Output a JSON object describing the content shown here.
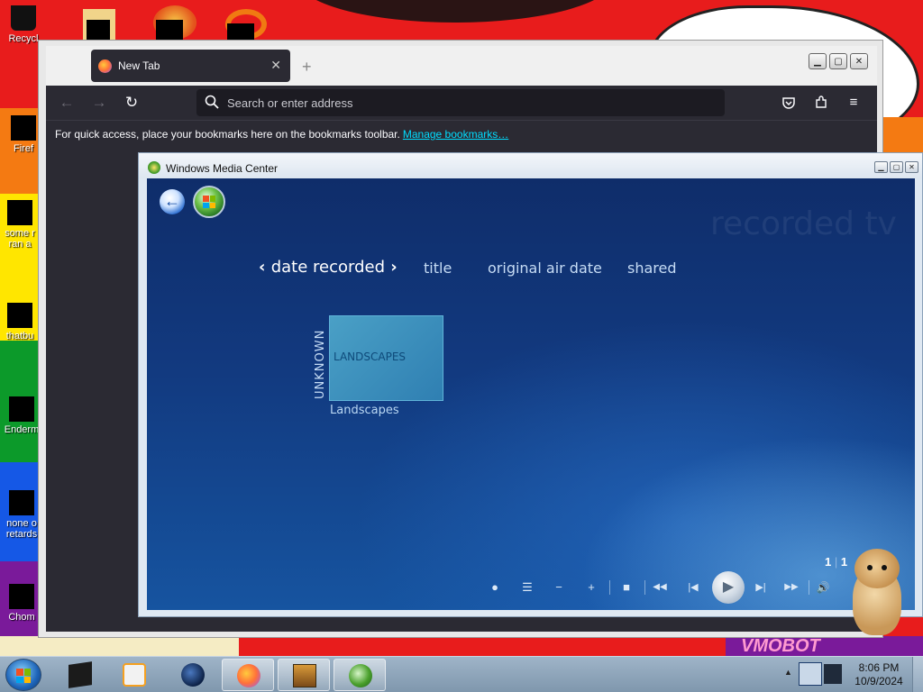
{
  "desktop": {
    "icons": [
      {
        "label": "Recycl",
        "icon": "recycle-bin-icon"
      },
      {
        "label": "Firef",
        "icon": "firefox-icon"
      },
      {
        "label": "some r",
        "label2": "ran a",
        "icon": "file-icon"
      },
      {
        "label": "thatbu",
        "icon": "file-icon"
      },
      {
        "label": "Enderm",
        "icon": "file-icon"
      },
      {
        "label": "none o",
        "label2": "retards",
        "icon": "file-icon"
      },
      {
        "label": "Chom",
        "icon": "file-icon"
      }
    ],
    "wallpaper_text": "VMOBOT"
  },
  "firefox": {
    "tab_title": "New Tab",
    "url_placeholder": "Search or enter address",
    "bookmarks_hint": "For quick access, place your bookmarks here on the bookmarks toolbar.",
    "manage_bookmarks": "Manage bookmarks…",
    "new_tab_glyph": "+",
    "close_glyph": "✕"
  },
  "wmc": {
    "window_title": "Windows Media Center",
    "section_watermark": "recorded tv",
    "sort_options": [
      {
        "label": "date recorded",
        "active": true
      },
      {
        "label": "title",
        "active": false
      },
      {
        "label": "original air date",
        "active": false
      },
      {
        "label": "shared",
        "active": false
      }
    ],
    "group_label": "UNKNOWN",
    "tile_text": "LANDSCAPES",
    "tile_caption": "Landscapes",
    "page": {
      "current": "1",
      "total": "1"
    },
    "transport": [
      {
        "name": "record-icon",
        "glyph": "●"
      },
      {
        "name": "guide-list-icon",
        "glyph": "☰"
      },
      {
        "name": "volume-down-icon",
        "glyph": "−"
      },
      {
        "name": "volume-up-icon",
        "glyph": "+"
      },
      {
        "name": "stop-icon",
        "glyph": "■"
      },
      {
        "name": "rewind-icon",
        "glyph": "◀◀"
      },
      {
        "name": "skip-back-icon",
        "glyph": "|◀"
      },
      {
        "name": "skip-forward-icon",
        "glyph": "▶|"
      },
      {
        "name": "fast-forward-icon",
        "glyph": "▶▶"
      },
      {
        "name": "mute-icon",
        "glyph": "🔊"
      }
    ],
    "play_glyph": "▶"
  },
  "taskbar": {
    "items": [
      {
        "name": "taskbar-item-media",
        "open": false
      },
      {
        "name": "taskbar-item-wmp",
        "open": false
      },
      {
        "name": "taskbar-item-globe",
        "open": false
      },
      {
        "name": "taskbar-item-firefox",
        "open": true
      },
      {
        "name": "taskbar-item-box",
        "open": true
      },
      {
        "name": "taskbar-item-wmc",
        "open": true
      }
    ],
    "clock_time": "8:06 PM",
    "clock_date": "10/9/2024"
  },
  "colors": {
    "wmc_bg": "#123a80",
    "firefox_chrome": "#2b2a33",
    "link": "#00ddff",
    "wallpaper_red": "#e81c1c"
  }
}
